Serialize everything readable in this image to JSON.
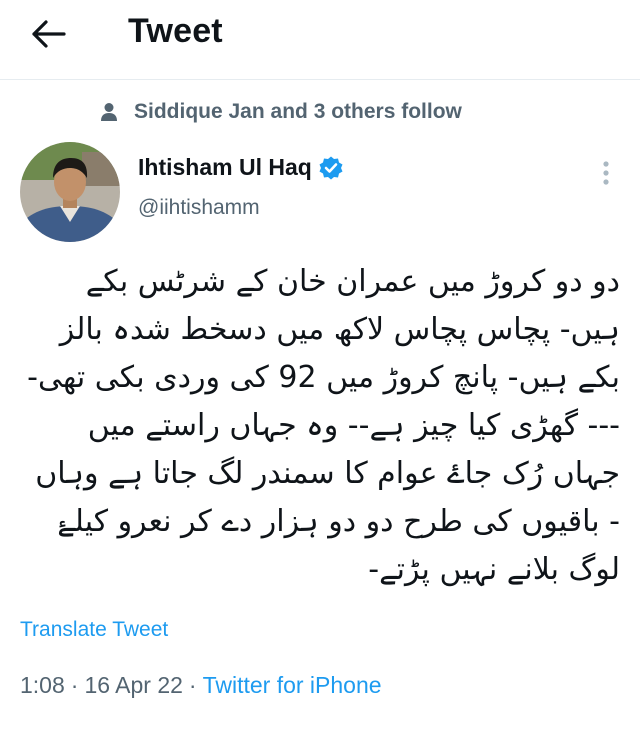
{
  "header": {
    "title": "Tweet",
    "back_icon": "arrow-left-icon"
  },
  "social_context": {
    "text": "Siddique Jan and 3 others follow",
    "icon": "person-icon"
  },
  "author": {
    "name": "Ihtisham Ul Haq",
    "handle": "@iihtishamm",
    "verified_icon": "verified-badge-icon",
    "verified_color": "#1d9bf0"
  },
  "tweet": {
    "text": "دو دو کروڑ میں عمران خان کے شرٹس بکے ہیں- پچاس پچاس لاکھ میں دسخط شدہ بالز بکے ہیں- پانچ کروڑ میں 92 کی وردی بکی تھی---- گھڑی کیا چیز ہے-- وہ جہاں راستے میں جہاں رُک جاۓ عوام کا سمندر لگ جاتا ہے وہاں - باقیوں کی طرح دو دو ہزار دے کر نعرو کیلۓ لوگ بلانے نہیں پڑتے-",
    "translate_label": "Translate Tweet"
  },
  "meta": {
    "time": "1:08",
    "sep1": "·",
    "date": "16 Apr 22",
    "sep2": "·",
    "source": "Twitter for iPhone"
  },
  "colors": {
    "accent": "#1d9bf0",
    "secondary_text": "#536471",
    "primary_text": "#0f1419"
  }
}
